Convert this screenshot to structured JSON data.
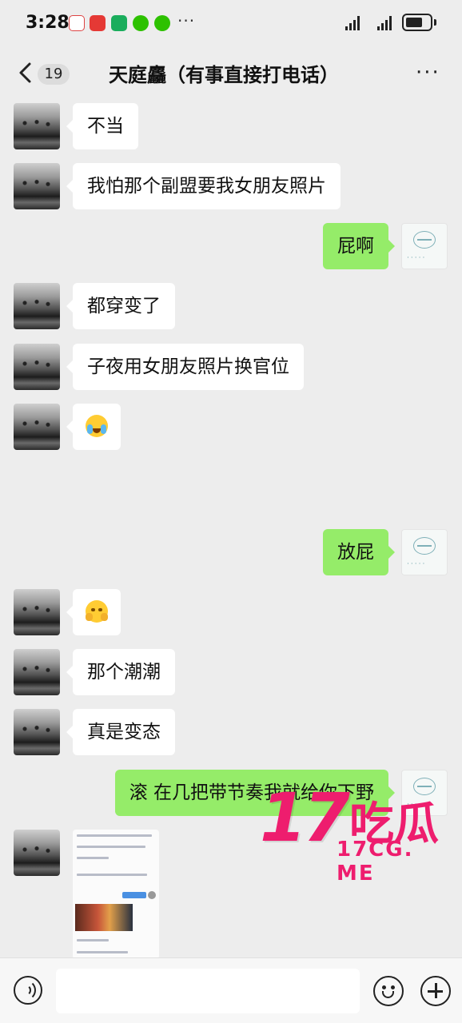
{
  "status_bar": {
    "time": "3:28",
    "more": "···"
  },
  "nav": {
    "back_count": "19",
    "title": "天庭麤（有事直接打电话）",
    "more": "···"
  },
  "messages": [
    {
      "side": "left",
      "type": "text",
      "text": "不当"
    },
    {
      "side": "left",
      "type": "text",
      "text": "我怕那个副盟要我女朋友照片"
    },
    {
      "side": "right",
      "type": "text",
      "text": "屁啊"
    },
    {
      "side": "left",
      "type": "text",
      "text": "都穿变了"
    },
    {
      "side": "left",
      "type": "text",
      "text": "子夜用女朋友照片换官位"
    },
    {
      "side": "left",
      "type": "emoji",
      "emoji": "crying-face-emoji"
    },
    {
      "side": "right",
      "type": "text",
      "text": "放屁"
    },
    {
      "side": "left",
      "type": "emoji",
      "emoji": "shy-face-emoji"
    },
    {
      "side": "left",
      "type": "text",
      "text": "那个潮潮"
    },
    {
      "side": "left",
      "type": "text",
      "text": "真是变态"
    },
    {
      "side": "right",
      "type": "text",
      "text": "滚 在几把带节奏我就给你下野"
    },
    {
      "side": "left",
      "type": "image",
      "image": "chat-screenshot-thumbnail"
    }
  ],
  "watermark": {
    "number": "17",
    "cn": "吃瓜",
    "domain": "17CG. ME"
  },
  "colors": {
    "sent_bubble": "#95ec69",
    "received_bubble": "#ffffff",
    "background": "#ededed",
    "watermark": "#ee1d6e"
  }
}
